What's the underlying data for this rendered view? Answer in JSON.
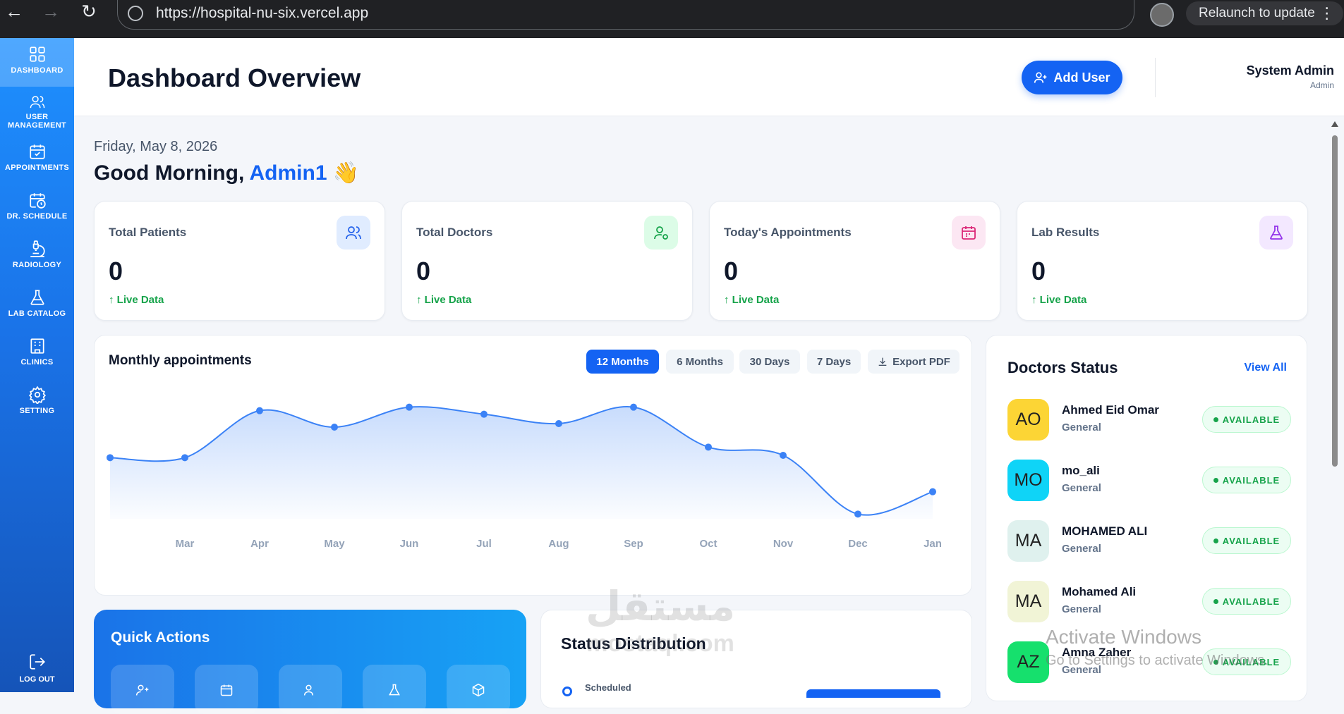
{
  "browser": {
    "url": "https://hospital-nu-six.vercel.app",
    "relaunch_label": "Relaunch to update"
  },
  "sidebar": {
    "items": [
      {
        "label": "DASHBOARD",
        "icon": "grid-icon",
        "active": true
      },
      {
        "label": "USER MANAGEMENT",
        "icon": "users-icon",
        "active": false
      },
      {
        "label": "APPOINTMENTS",
        "icon": "calendar-check-icon",
        "active": false
      },
      {
        "label": "DR. SCHEDULE",
        "icon": "calendar-clock-icon",
        "active": false
      },
      {
        "label": "RADIOLOGY",
        "icon": "microscope-icon",
        "active": false
      },
      {
        "label": "LAB CATALOG",
        "icon": "flask-icon",
        "active": false
      },
      {
        "label": "CLINICS",
        "icon": "building-icon",
        "active": false
      },
      {
        "label": "SETTING",
        "icon": "gear-icon",
        "active": false
      }
    ],
    "logout_label": "LOG OUT"
  },
  "header": {
    "title": "Dashboard Overview",
    "add_user_label": "Add User",
    "user_name": "System Admin",
    "user_role": "Admin"
  },
  "welcome": {
    "date": "Friday, May 8, 2026",
    "greeting": "Good Morning,",
    "name": "Admin1",
    "emoji": "👋"
  },
  "stats": [
    {
      "label": "Total Patients",
      "value": "0",
      "trend": "Live Data",
      "icon": "users-icon",
      "color": "#2563eb",
      "bg": "#e0ecff"
    },
    {
      "label": "Total Doctors",
      "value": "0",
      "trend": "Live Data",
      "icon": "user-cog-icon",
      "color": "#16a34a",
      "bg": "#dcfce7"
    },
    {
      "label": "Today's Appointments",
      "value": "0",
      "trend": "Live Data",
      "icon": "calendar-icon",
      "color": "#db2777",
      "bg": "#fce7f3"
    },
    {
      "label": "Lab Results",
      "value": "0",
      "trend": "Live Data",
      "icon": "flask-icon",
      "color": "#9333ea",
      "bg": "#f3e8ff"
    }
  ],
  "chart": {
    "title": "Monthly appointments",
    "ranges": [
      "12 Months",
      "6 Months",
      "30 Days",
      "7 Days"
    ],
    "active_range": "12 Months",
    "export_label": "Export PDF"
  },
  "chart_data": {
    "type": "area",
    "categories": [
      "",
      "Mar",
      "Apr",
      "May",
      "Jun",
      "Jul",
      "Aug",
      "Sep",
      "Oct",
      "Nov",
      "Dec",
      "Jan"
    ],
    "values": [
      52,
      52,
      92,
      78,
      95,
      89,
      81,
      95,
      61,
      54,
      4,
      23
    ],
    "ylim": [
      0,
      120
    ],
    "grid": false,
    "color": "#3b82f6"
  },
  "doctors": {
    "title": "Doctors Status",
    "view_all_label": "View All",
    "items": [
      {
        "initials": "AO",
        "name": "Ahmed Eid Omar",
        "specialty": "General",
        "status": "AVAILABLE",
        "color": "#fcd535"
      },
      {
        "initials": "MO",
        "name": "mo_ali",
        "specialty": "General",
        "status": "AVAILABLE",
        "color": "#0fd4f7"
      },
      {
        "initials": "MA",
        "name": "MOHAMED ALI",
        "specialty": "General",
        "status": "AVAILABLE",
        "color": "#dff1ee"
      },
      {
        "initials": "MA",
        "name": "Mohamed Ali",
        "specialty": "General",
        "status": "AVAILABLE",
        "color": "#f1f4d6"
      },
      {
        "initials": "AZ",
        "name": "Amna Zaher",
        "specialty": "General",
        "status": "AVAILABLE",
        "color": "#16e06d"
      }
    ]
  },
  "quick_actions": {
    "title": "Quick Actions",
    "icons": [
      "user-plus-icon",
      "calendar-icon",
      "users-icon",
      "flask-icon",
      "package-icon"
    ]
  },
  "status_distribution": {
    "title": "Status Distribution",
    "legend_first": "Scheduled"
  },
  "overlays": {
    "watermark_ar": "مستقل",
    "watermark_en": "mostaql.com",
    "activate_title": "Activate Windows",
    "activate_sub": "Go to Settings to activate Windows."
  }
}
